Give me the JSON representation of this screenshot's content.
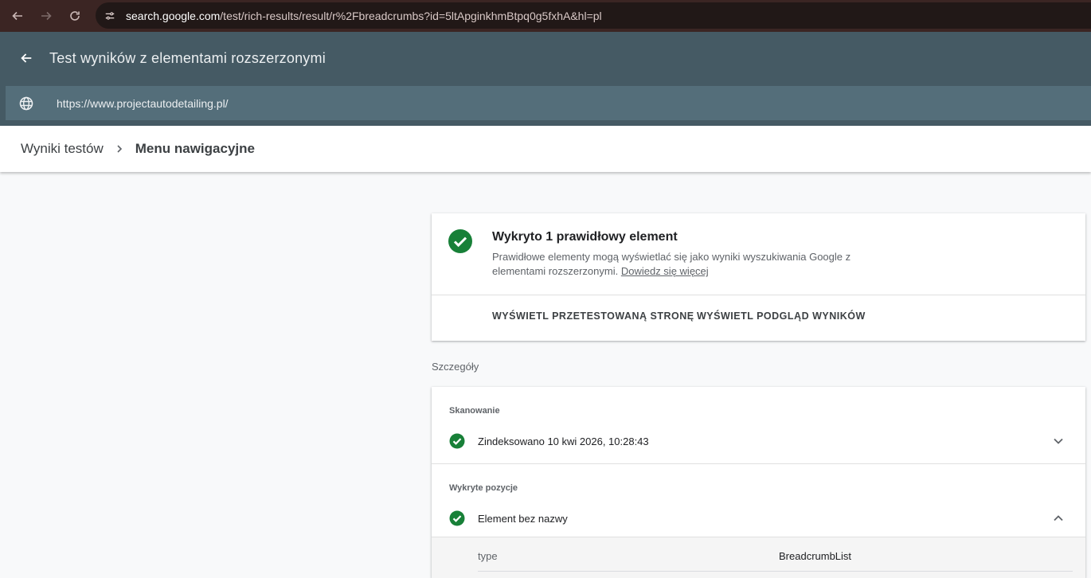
{
  "browser": {
    "url_host": "search.google.com",
    "url_path": "/test/rich-results/result/r%2Fbreadcrumbs?id=5ltApginkhmBtpq0g5fxhA&hl=pl"
  },
  "app": {
    "title": "Test wyników z elementami rozszerzonymi",
    "tested_url": "https://www.projectautodetailing.pl/"
  },
  "breadcrumb": {
    "parent": "Wyniki testów",
    "current": "Menu nawigacyjne"
  },
  "summary": {
    "heading": "Wykryto 1 prawidłowy element",
    "description": "Prawidłowe elementy mogą wyświetlać się jako wyniki wyszukiwania Google z elementami rozszerzonymi.",
    "learn_more": "Dowiedz się więcej",
    "view_tested_page": "WYŚWIETL PRZETESTOWANĄ STRONĘ",
    "view_preview": "WYŚWIETL PODGLĄD WYNIKÓW"
  },
  "details": {
    "label": "Szczegóły",
    "crawl": {
      "title": "Skanowanie",
      "status": "Zindeksowano 10 kwi 2026, 10:28:43"
    },
    "detected": {
      "title": "Wykryte pozycje",
      "item": "Element bez nazwy",
      "properties": [
        {
          "key": "type",
          "value": "BreadcrumbList"
        }
      ]
    }
  },
  "colors": {
    "success": "#188038",
    "header": "#455a64"
  }
}
